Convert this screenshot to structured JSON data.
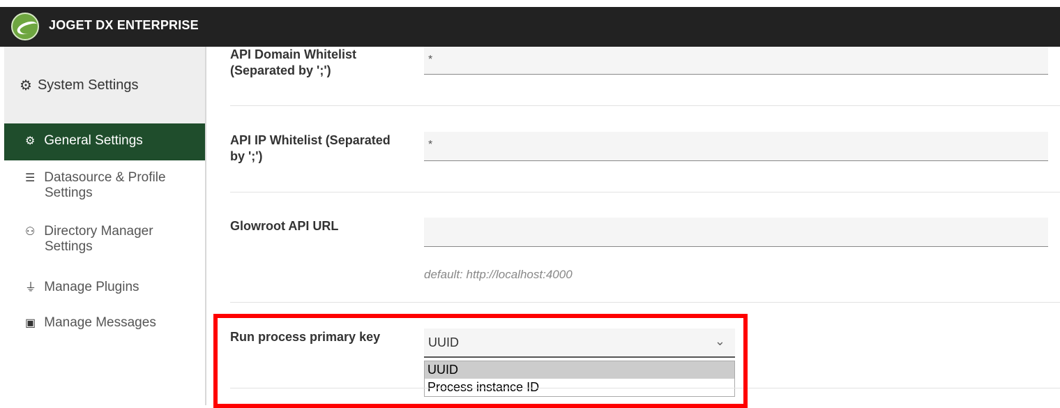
{
  "app": {
    "title": "JOGET DX ENTERPRISE"
  },
  "sidebar": {
    "header": "System Settings",
    "items": [
      {
        "label": "General Settings",
        "icon": "gear-icon"
      },
      {
        "label": "Datasource & Profile",
        "label2": "Settings",
        "icon": "database-icon"
      },
      {
        "label": "Directory Manager",
        "label2": "Settings",
        "icon": "users-gear-icon"
      },
      {
        "label": "Manage Plugins",
        "icon": "plug-icon"
      },
      {
        "label": "Manage Messages",
        "icon": "language-icon"
      }
    ]
  },
  "form": {
    "api_domain_label_line1": "API Domain Whitelist",
    "api_domain_label_line2": "(Separated by ';')",
    "api_domain_value": "*",
    "api_ip_label_line1": "API IP Whitelist (Separated",
    "api_ip_label_line2": "by ';')",
    "api_ip_value": "*",
    "glowroot_label": "Glowroot API URL",
    "glowroot_value": "",
    "glowroot_hint": "default: http://localhost:4000",
    "run_process_label": "Run process primary key",
    "run_process_selected": "UUID",
    "run_process_options": [
      "UUID",
      "Process instance ID"
    ]
  },
  "colors": {
    "topbar": "#222222",
    "active_nav": "#1f4d2c",
    "highlight": "#ff0000"
  }
}
